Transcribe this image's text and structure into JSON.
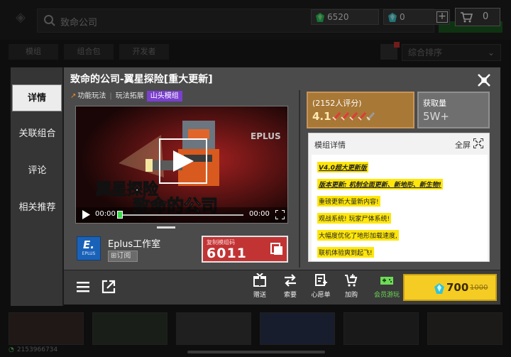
{
  "store": {
    "search_text": "致命公司",
    "emerald_count": "6520",
    "diamond_count": "0",
    "cart_count": "0",
    "tabs": [
      "模组",
      "组合包",
      "开发者"
    ],
    "sort_label": "综合排序"
  },
  "status_bar": {
    "number": "2153966734"
  },
  "sidebar": {
    "items": [
      {
        "label": "详情",
        "active": true
      },
      {
        "label": "关联组合",
        "active": false
      },
      {
        "label": "评论",
        "active": false
      },
      {
        "label": "相关推荐",
        "active": false
      }
    ]
  },
  "mod": {
    "title": "致命的公司-翼星探险[重大更新]",
    "tags": [
      "功能玩法",
      "玩法拓展"
    ],
    "badge": "山头模组"
  },
  "video": {
    "current_time": "00:00",
    "duration": "00:00"
  },
  "author": {
    "logo_text": "E.",
    "logo_sub": "EPLUS",
    "name": "Eplus工作室",
    "follow_label": "订阅"
  },
  "copy_code": {
    "label": "复制模组码",
    "code": "6011"
  },
  "rating": {
    "count_text": "(2152人评分)",
    "score": "4.1",
    "swords_total": 5,
    "swords_full": 4
  },
  "obtain": {
    "label": "获取量",
    "value": "5W+"
  },
  "details": {
    "title": "模组详情",
    "fullscreen_label": "全屏",
    "lines": [
      "V4.0超大更新版",
      "版本更新: 机制全面更新、新地形、新生物!",
      "重磅更新大量新内容!",
      "观战系统! 玩家尸体系统!",
      "大幅度优化了地形加载速度,",
      "联机体验爽到起飞!"
    ]
  },
  "footer": {
    "gift_label": "赠送",
    "request_label": "索要",
    "wishlist_label": "心愿单",
    "add_cart_label": "加购",
    "vip_label": "会员游玩",
    "price": "700",
    "old_price": "1000"
  },
  "colors": {
    "accent_yellow": "#f5cc24",
    "badge_purple": "#7a3fcf",
    "code_red": "#c23434",
    "rating_gold": "#a87836",
    "vip_green": "#6ddb55"
  }
}
